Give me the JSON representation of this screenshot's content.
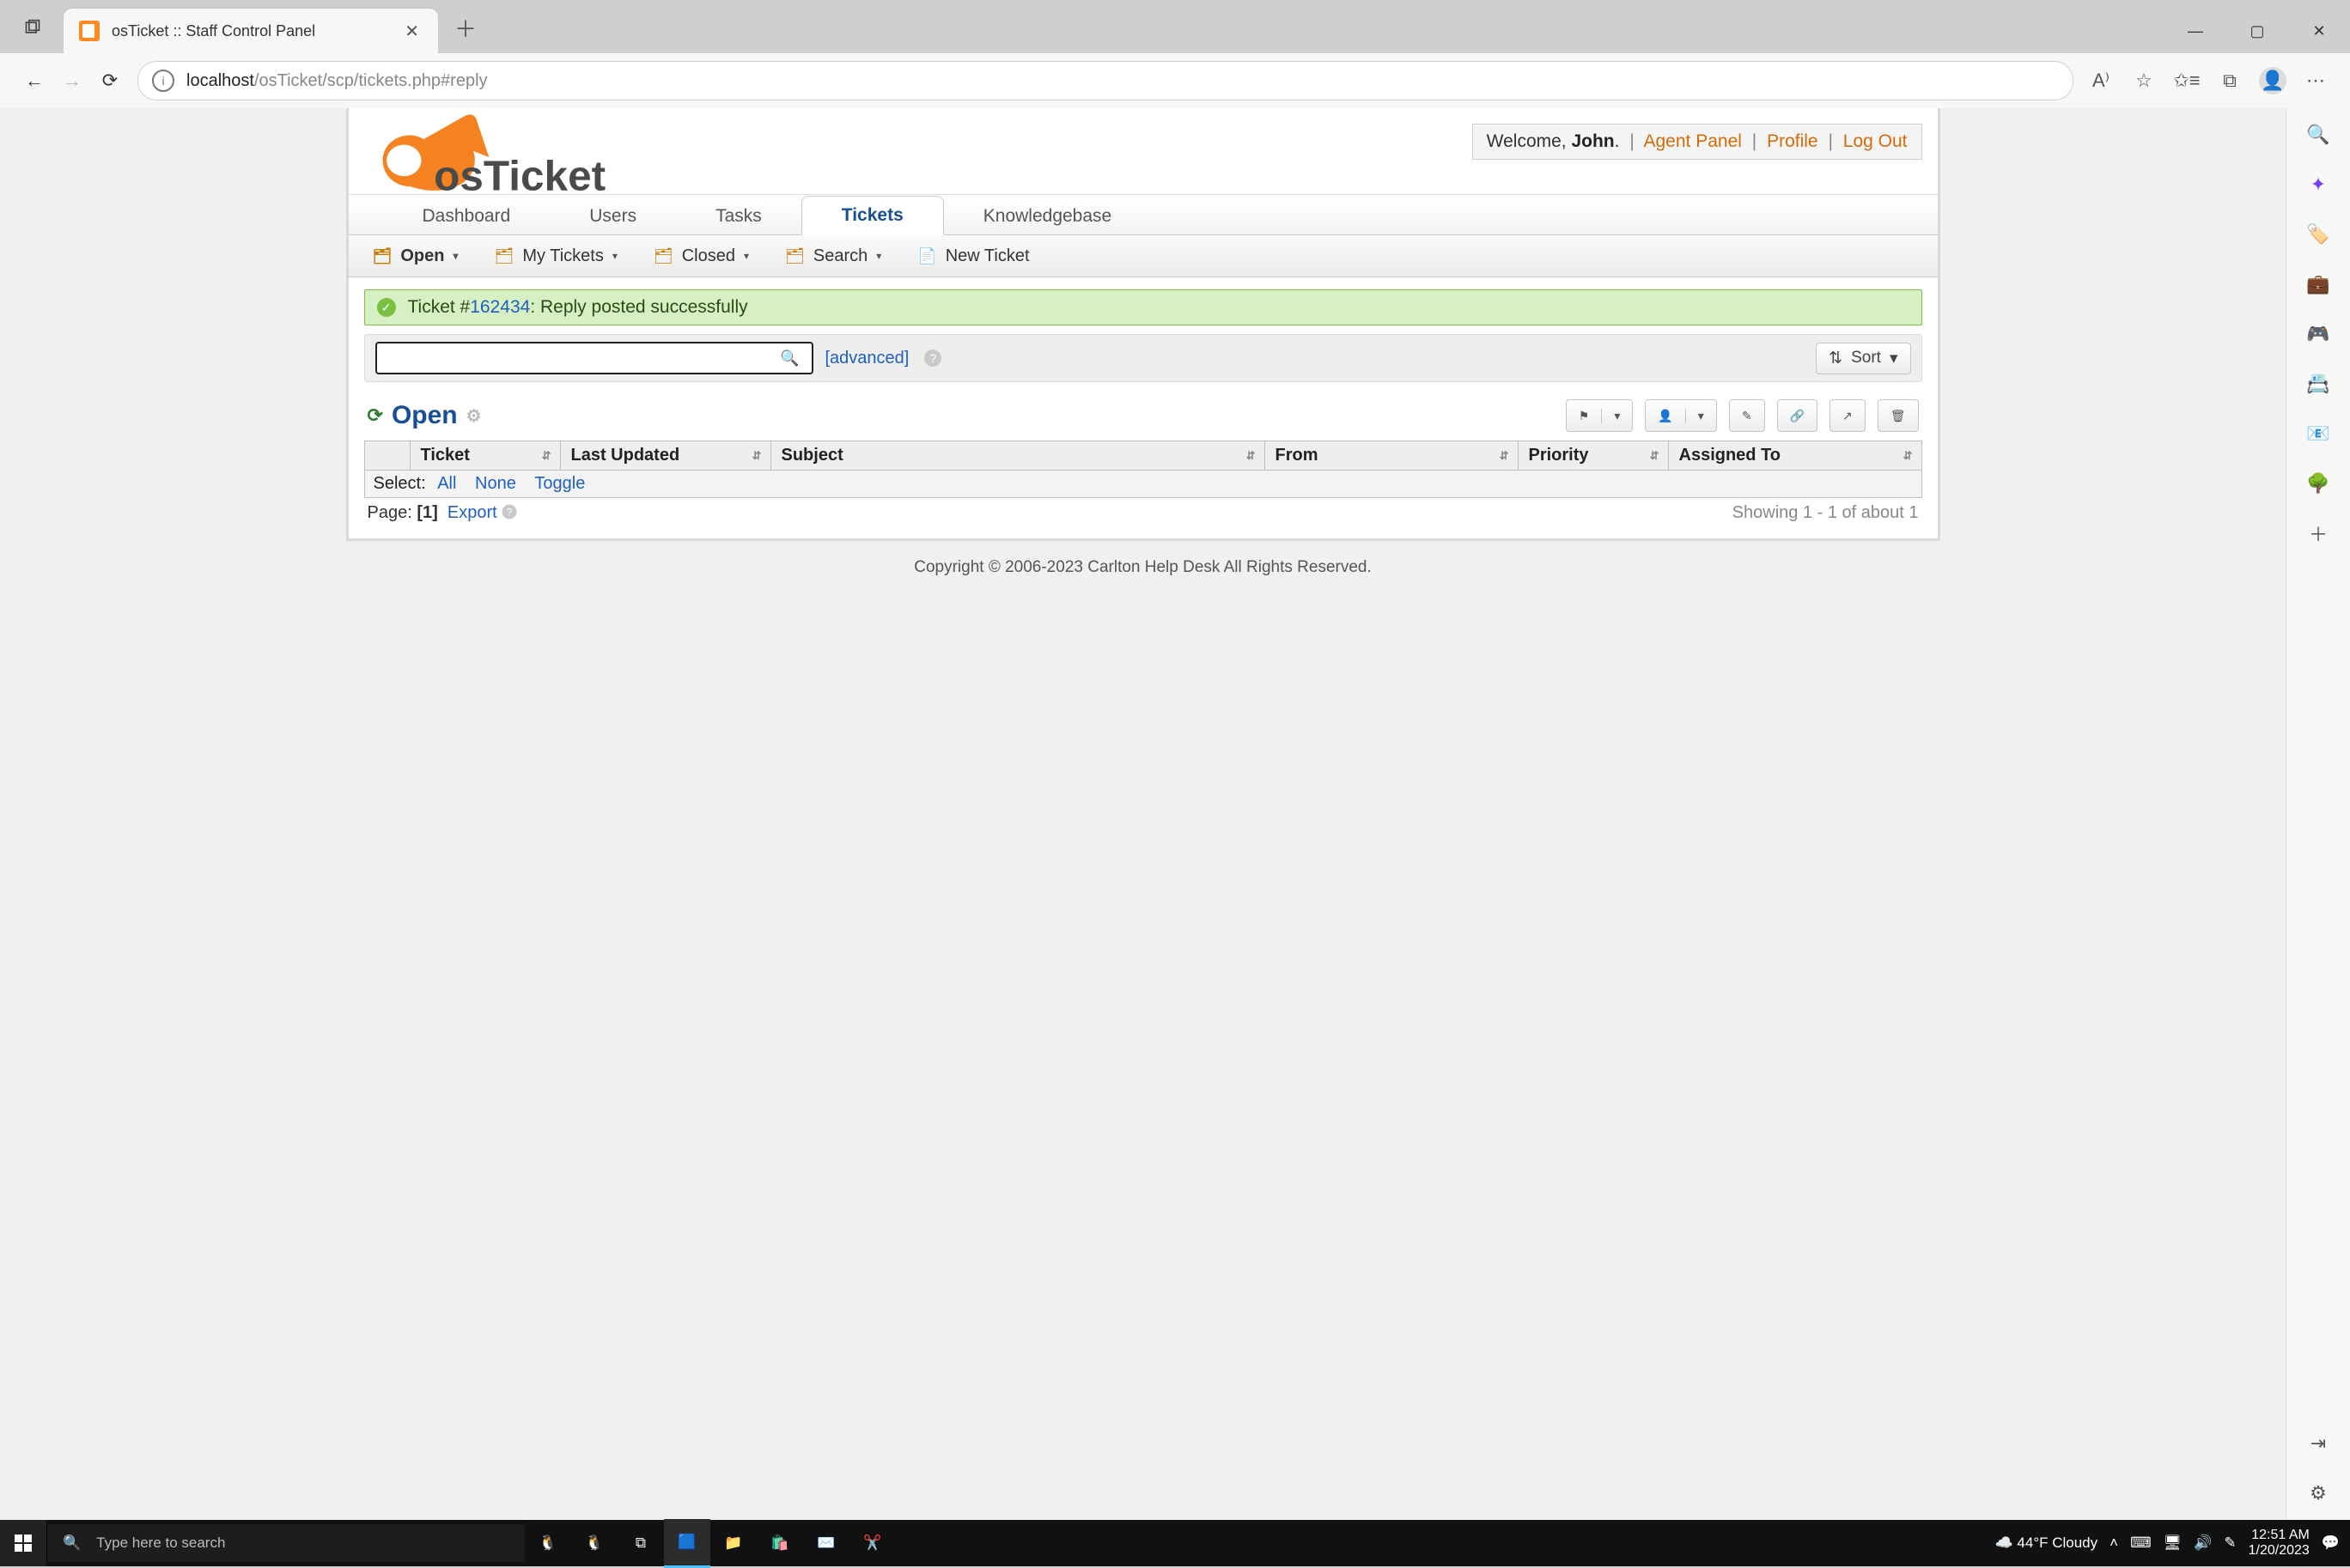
{
  "browser": {
    "tab_title": "osTicket :: Staff Control Panel",
    "url_host": "localhost",
    "url_path": "/osTicket/scp/tickets.php#reply"
  },
  "header": {
    "welcome_prefix": "Welcome, ",
    "user_name": "John",
    "user_suffix": ".",
    "agent_panel": "Agent Panel",
    "profile": "Profile",
    "logout": "Log Out"
  },
  "mainnav": {
    "dashboard": "Dashboard",
    "users": "Users",
    "tasks": "Tasks",
    "tickets": "Tickets",
    "kb": "Knowledgebase"
  },
  "subnav": {
    "open": "Open",
    "my_tickets": "My Tickets",
    "closed": "Closed",
    "search": "Search",
    "new_ticket": "New Ticket"
  },
  "alert": {
    "prefix": "Ticket #",
    "ticket_number": "162434",
    "suffix": ": Reply posted successfully"
  },
  "search": {
    "value": "",
    "placeholder": "",
    "advanced": "[advanced]",
    "sort": "Sort"
  },
  "queue": {
    "title": "Open"
  },
  "columns": {
    "ticket": "Ticket",
    "last_updated": "Last Updated",
    "subject": "Subject",
    "from": "From",
    "priority": "Priority",
    "assigned": "Assigned To"
  },
  "selectbar": {
    "label": "Select:",
    "all": "All",
    "none": "None",
    "toggle": "Toggle"
  },
  "pager": {
    "page_label": "Page:",
    "page_value": "[1]",
    "export": "Export",
    "showing": "Showing 1 - 1 of about 1"
  },
  "footer": {
    "text": "Copyright © 2006-2023 Carlton Help Desk All Rights Reserved."
  },
  "taskbar": {
    "search_placeholder": "Type here to search",
    "weather": "44°F  Cloudy",
    "time": "12:51 AM",
    "date": "1/20/2023"
  }
}
